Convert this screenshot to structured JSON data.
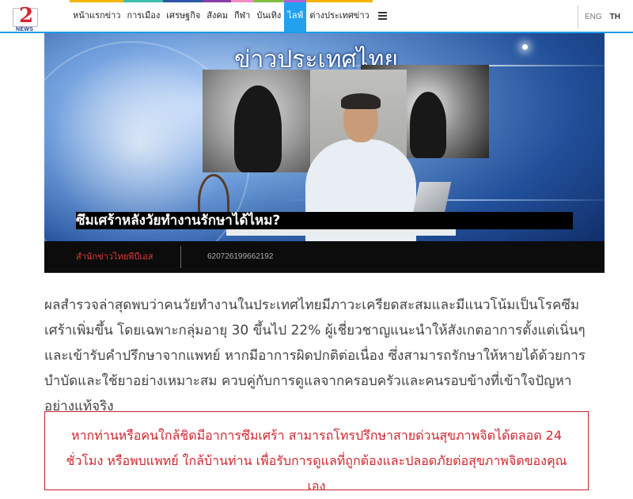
{
  "logo": {
    "number": "2",
    "wordmark": "NEWS"
  },
  "nav": {
    "items": [
      {
        "label": "หน้าแรกข่าว",
        "accent": "#f2b705",
        "active": false
      },
      {
        "label": "การเมือง",
        "accent": "#3bbfae",
        "active": false
      },
      {
        "label": "เศรษฐกิจ",
        "accent": "#2c56a8",
        "active": false
      },
      {
        "label": "สังคม",
        "accent": "#8a3da6",
        "active": false
      },
      {
        "label": "กีฬา",
        "accent": "#f28ec7",
        "active": false
      },
      {
        "label": "บันเทิง",
        "accent": "#7fbf3f",
        "active": false
      },
      {
        "label": "ไลฟ์",
        "accent": "#b55fd1",
        "active": true
      },
      {
        "label": "ต่างประเทศข่าว",
        "accent": "#f5b400",
        "active": false
      }
    ],
    "more_icon": "hamburger-icon"
  },
  "lang": {
    "eng": "ENG",
    "th": "TH"
  },
  "hero": {
    "heading": "ข่าวประเทศไทย",
    "title": "ซึมเศร้าหลังวัยทำงานรักษาได้ไหม?",
    "source": "สำนักข่าวไทยพีบีเอส",
    "id": "620726199662192"
  },
  "article": {
    "paragraph": "ผลสำรวจล่าสุดพบว่าคนวัยทำงานในประเทศไทยมีภาวะเครียดสะสมและมีแนวโน้มเป็นโรคซึมเศร้าเพิ่มขึ้น โดยเฉพาะกลุ่มอายุ 30 ขึ้นไป 22% ผู้เชี่ยวชาญแนะนำให้สังเกตอาการตั้งแต่เนิ่นๆ และเข้ารับคำปรึกษาจากแพทย์ หากมีอาการผิดปกติต่อเนื่อง ซึ่งสามารถรักษาให้หายได้ด้วยการบำบัดและใช้ยาอย่างเหมาะสม ควบคู่กับการดูแลจากครอบครัวและคนรอบข้างที่เข้าใจปัญหาอย่างแท้จริง"
  },
  "note": {
    "text": "หากท่านหรือคนใกล้ชิดมีอาการซึมเศร้า สามารถโทรปรึกษาสายด่วนสุขภาพจิตได้ตลอด 24 ชั่วโมง หรือพบแพทย์ ใกล้บ้านท่าน เพื่อรับการดูแลที่ถูกต้องและปลอดภัยต่อสุขภาพจิตของคุณเอง"
  }
}
